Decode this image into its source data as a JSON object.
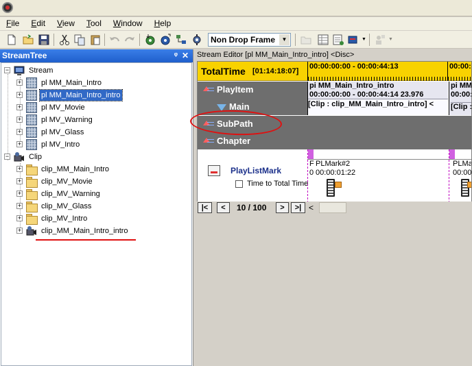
{
  "menu": {
    "items": [
      {
        "label_ul": "F",
        "label_rest": "ile"
      },
      {
        "label_ul": "E",
        "label_rest": "dit"
      },
      {
        "label_ul": "V",
        "label_rest": "iew"
      },
      {
        "label_ul": "T",
        "label_rest": "ool"
      },
      {
        "label_ul": "W",
        "label_rest": "indow"
      },
      {
        "label_ul": "H",
        "label_rest": "elp"
      }
    ]
  },
  "toolbar": {
    "frame_mode": "Non Drop Frame"
  },
  "stream_tree": {
    "title": "StreamTree",
    "pin_glyph": "ᵠ",
    "close_glyph": "✕",
    "stream_label": "Stream",
    "playlists": [
      "pl MM_Main_Intro",
      "pl MM_Main_Intro_intro",
      "pl MV_Movie",
      "pl MV_Warning",
      "pl MV_Glass",
      "pl MV_Intro"
    ],
    "selected_index": 1,
    "clip_label": "Clip",
    "clips": [
      "clip_MM_Main_Intro",
      "clip_MV_Movie",
      "clip_MV_Warning",
      "clip_MV_Glass",
      "clip_MV_Intro",
      "clip_MM_Main_Intro_intro"
    ]
  },
  "editor": {
    "title": "Stream Editor [pl MM_Main_Intro_intro] <Disc>",
    "total_time_label": "TotalTime",
    "total_time_value": "[01:14:18:07]",
    "range1": "00:00:00:00 - 00:00:44:13",
    "range2": "00:00:",
    "play_item_label": "PlayItem",
    "main_label": "Main",
    "subpath_label": "SubPath",
    "chapter_label": "Chapter",
    "play_item_name": "pi MM_Main_Intro_intro",
    "play_item_time": "00:00:00:00 - 00:00:44:14  23.976",
    "play_item_clip": "[Clip : clip_MM_Main_Intro_intro] <",
    "play_item2_name": "pi MM_",
    "play_item2_time": "00:00:",
    "play_item2_clip": "[Clip :",
    "playlist_mark_label": "PlayListMark",
    "time_to_total_label": "Time to Total Time",
    "mark_prefix1": "F",
    "mark_prefix2": "0",
    "mark1_label": "PLMark#2",
    "mark1_time": "00:00:01:22",
    "mark2_label": "PLMar",
    "mark2_time": "00:00:"
  },
  "nav": {
    "first": "|<",
    "prev": "<",
    "page": "10 / 100",
    "next": ">",
    "last": ">|",
    "scroll_left": "<"
  },
  "colors": {
    "header_blue": "#1f5fcc",
    "total_time_yellow": "#f8d200",
    "selection_blue": "#3169c6",
    "annotation_red": "#e01010"
  }
}
